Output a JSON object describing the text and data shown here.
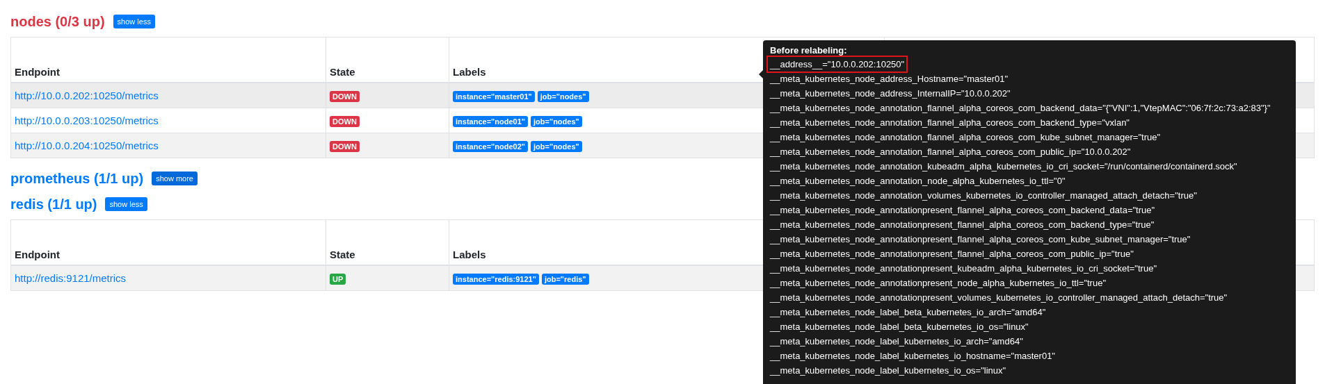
{
  "sections": [
    {
      "title": "nodes (0/3 up)",
      "healthy": false,
      "toggle": "show less",
      "expanded": true,
      "columns": [
        "Endpoint",
        "State",
        "Labels"
      ],
      "rows": [
        {
          "endpoint": "http://10.0.0.202:10250/metrics",
          "state": "DOWN",
          "up": false,
          "hovered": true,
          "labels": [
            "instance=\"master01\"",
            "job=\"nodes\""
          ]
        },
        {
          "endpoint": "http://10.0.0.203:10250/metrics",
          "state": "DOWN",
          "up": false,
          "hovered": false,
          "labels": [
            "instance=\"node01\"",
            "job=\"nodes\""
          ]
        },
        {
          "endpoint": "http://10.0.0.204:10250/metrics",
          "state": "DOWN",
          "up": false,
          "hovered": false,
          "labels": [
            "instance=\"node02\"",
            "job=\"nodes\""
          ]
        }
      ]
    },
    {
      "title": "prometheus (1/1 up)",
      "healthy": true,
      "toggle": "show more",
      "expanded": false
    },
    {
      "title": "redis (1/1 up)",
      "healthy": true,
      "toggle": "show less",
      "expanded": true,
      "columns": [
        "Endpoint",
        "State",
        "Labels"
      ],
      "rows": [
        {
          "endpoint": "http://redis:9121/metrics",
          "state": "UP",
          "up": true,
          "hovered": false,
          "labels": [
            "instance=\"redis:9121\"",
            "job=\"redis\""
          ]
        }
      ]
    }
  ],
  "tooltip": {
    "title": "Before relabeling:",
    "lines": [
      {
        "text": "__address__=\"10.0.0.202:10250\"",
        "highlighted": true
      },
      {
        "text": "__meta_kubernetes_node_address_Hostname=\"master01\"",
        "highlighted": false
      },
      {
        "text": "__meta_kubernetes_node_address_InternalIP=\"10.0.0.202\"",
        "highlighted": false
      },
      {
        "text": "__meta_kubernetes_node_annotation_flannel_alpha_coreos_com_backend_data=\"{\"VNI\":1,\"VtepMAC\":\"06:7f:2c:73:a2:83\"}\"",
        "highlighted": false
      },
      {
        "text": "__meta_kubernetes_node_annotation_flannel_alpha_coreos_com_backend_type=\"vxlan\"",
        "highlighted": false
      },
      {
        "text": "__meta_kubernetes_node_annotation_flannel_alpha_coreos_com_kube_subnet_manager=\"true\"",
        "highlighted": false
      },
      {
        "text": "__meta_kubernetes_node_annotation_flannel_alpha_coreos_com_public_ip=\"10.0.0.202\"",
        "highlighted": false
      },
      {
        "text": "__meta_kubernetes_node_annotation_kubeadm_alpha_kubernetes_io_cri_socket=\"/run/containerd/containerd.sock\"",
        "highlighted": false
      },
      {
        "text": "__meta_kubernetes_node_annotation_node_alpha_kubernetes_io_ttl=\"0\"",
        "highlighted": false
      },
      {
        "text": "__meta_kubernetes_node_annotation_volumes_kubernetes_io_controller_managed_attach_detach=\"true\"",
        "highlighted": false
      },
      {
        "text": "__meta_kubernetes_node_annotationpresent_flannel_alpha_coreos_com_backend_data=\"true\"",
        "highlighted": false
      },
      {
        "text": "__meta_kubernetes_node_annotationpresent_flannel_alpha_coreos_com_backend_type=\"true\"",
        "highlighted": false
      },
      {
        "text": "__meta_kubernetes_node_annotationpresent_flannel_alpha_coreos_com_kube_subnet_manager=\"true\"",
        "highlighted": false
      },
      {
        "text": "__meta_kubernetes_node_annotationpresent_flannel_alpha_coreos_com_public_ip=\"true\"",
        "highlighted": false
      },
      {
        "text": "__meta_kubernetes_node_annotationpresent_kubeadm_alpha_kubernetes_io_cri_socket=\"true\"",
        "highlighted": false
      },
      {
        "text": "__meta_kubernetes_node_annotationpresent_node_alpha_kubernetes_io_ttl=\"true\"",
        "highlighted": false
      },
      {
        "text": "__meta_kubernetes_node_annotationpresent_volumes_kubernetes_io_controller_managed_attach_detach=\"true\"",
        "highlighted": false
      },
      {
        "text": "__meta_kubernetes_node_label_beta_kubernetes_io_arch=\"amd64\"",
        "highlighted": false
      },
      {
        "text": "__meta_kubernetes_node_label_beta_kubernetes_io_os=\"linux\"",
        "highlighted": false
      },
      {
        "text": "__meta_kubernetes_node_label_kubernetes_io_arch=\"amd64\"",
        "highlighted": false
      },
      {
        "text": "__meta_kubernetes_node_label_kubernetes_io_hostname=\"master01\"",
        "highlighted": false
      },
      {
        "text": "__meta_kubernetes_node_label_kubernetes_io_os=\"linux\"",
        "highlighted": false
      }
    ]
  }
}
